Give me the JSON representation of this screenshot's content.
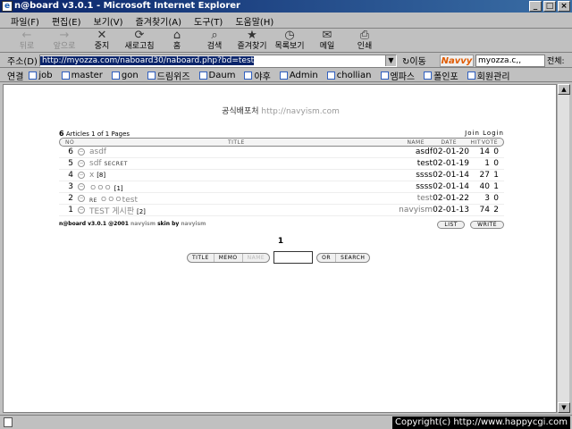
{
  "window": {
    "title": "n@board v3.0.1 - Microsoft Internet Explorer",
    "buttons": [
      "_",
      "□",
      "×"
    ]
  },
  "menu": [
    "파일(F)",
    "편집(E)",
    "보기(V)",
    "즐겨찾기(A)",
    "도구(T)",
    "도움말(H)"
  ],
  "toolbar": [
    {
      "label": "뒤로",
      "icon": "←",
      "disabled": true
    },
    {
      "label": "앞으로",
      "icon": "→",
      "disabled": true
    },
    {
      "label": "중지",
      "icon": "✕",
      "disabled": false
    },
    {
      "label": "새로고침",
      "icon": "⟳",
      "disabled": false
    },
    {
      "label": "홈",
      "icon": "⌂",
      "disabled": false
    },
    {
      "label": "검색",
      "icon": "⌕",
      "disabled": false
    },
    {
      "label": "즐겨찾기",
      "icon": "★",
      "disabled": false
    },
    {
      "label": "목록보기",
      "icon": "◷",
      "disabled": false
    },
    {
      "label": "메일",
      "icon": "✉",
      "disabled": false
    },
    {
      "label": "인쇄",
      "icon": "⎙",
      "disabled": false
    }
  ],
  "address": {
    "label": "주소(D)",
    "value": "http://myozza.com/naboard30/naboard.php?bd=test",
    "go_label": "↻이동"
  },
  "navvy": {
    "logo": "Navvy",
    "value": "myozza.c,,",
    "all_label": "전체:"
  },
  "links": {
    "label": "연결",
    "items": [
      "job",
      "master",
      "gon",
      "드림위즈",
      "Daum",
      "야후",
      "Admin",
      "chollian",
      "엠파스",
      "폴인포",
      "회원관리"
    ]
  },
  "board": {
    "site_title": "공식배포처",
    "site_url": "http://navyism.com",
    "article_count": "6",
    "article_info": "Articles 1 of 1 Pages",
    "join_login": "Join Login",
    "headers": {
      "no": "NO",
      "title": "TITLE",
      "name": "NAME",
      "date": "DATE",
      "hit": "HIT",
      "vote": "VOTE"
    },
    "rows": [
      {
        "no": "6",
        "circle": "−",
        "title": "asdf",
        "secret": "",
        "comment": "",
        "name": "asdf",
        "date": "02-01-20",
        "hit": "14",
        "vote": "0",
        "gray_title": true,
        "gray_name": false
      },
      {
        "no": "5",
        "circle": "−",
        "title": "sdf",
        "secret": "SECRET",
        "comment": "",
        "name": "test",
        "date": "02-01-19",
        "hit": "1",
        "vote": "0",
        "gray_title": true,
        "gray_name": false
      },
      {
        "no": "4",
        "circle": "−",
        "title": "x",
        "secret": "",
        "comment": "[8]",
        "name": "ssss",
        "date": "02-01-14",
        "hit": "27",
        "vote": "1",
        "gray_title": true,
        "gray_name": false
      },
      {
        "no": "3",
        "circle": "−",
        "title": "ㅇㅇㅇ",
        "secret": "",
        "comment": "[1]",
        "name": "ssss",
        "date": "02-01-14",
        "hit": "40",
        "vote": "1",
        "gray_title": true,
        "gray_name": false
      },
      {
        "no": "2",
        "circle": "−",
        "title": "ㅇㅇㅇtest",
        "secret": "RE",
        "comment": "",
        "name": "test",
        "date": "02-01-22",
        "hit": "3",
        "vote": "0",
        "gray_title": true,
        "gray_name": true
      },
      {
        "no": "1",
        "circle": "−",
        "title": "TEST 게시판",
        "secret": "",
        "comment": "[2]",
        "name": "navyism",
        "date": "02-01-13",
        "hit": "74",
        "vote": "2",
        "gray_title": true,
        "gray_name": true
      }
    ],
    "credit_prefix": "n@board v3.0.1 @2001",
    "credit_navyism": "navyism",
    "credit_skin": "skin by",
    "credit_skin_author": "navyism",
    "list_btn": "LIST",
    "write_btn": "WRITE",
    "page": "1",
    "search_fields": [
      "TITLE",
      "MEMO",
      "NAME"
    ],
    "or_btn": "OR",
    "search_btn": "SEARCH"
  },
  "status": {
    "copyright": "Copyright(c) http://www.happycgi.com"
  }
}
